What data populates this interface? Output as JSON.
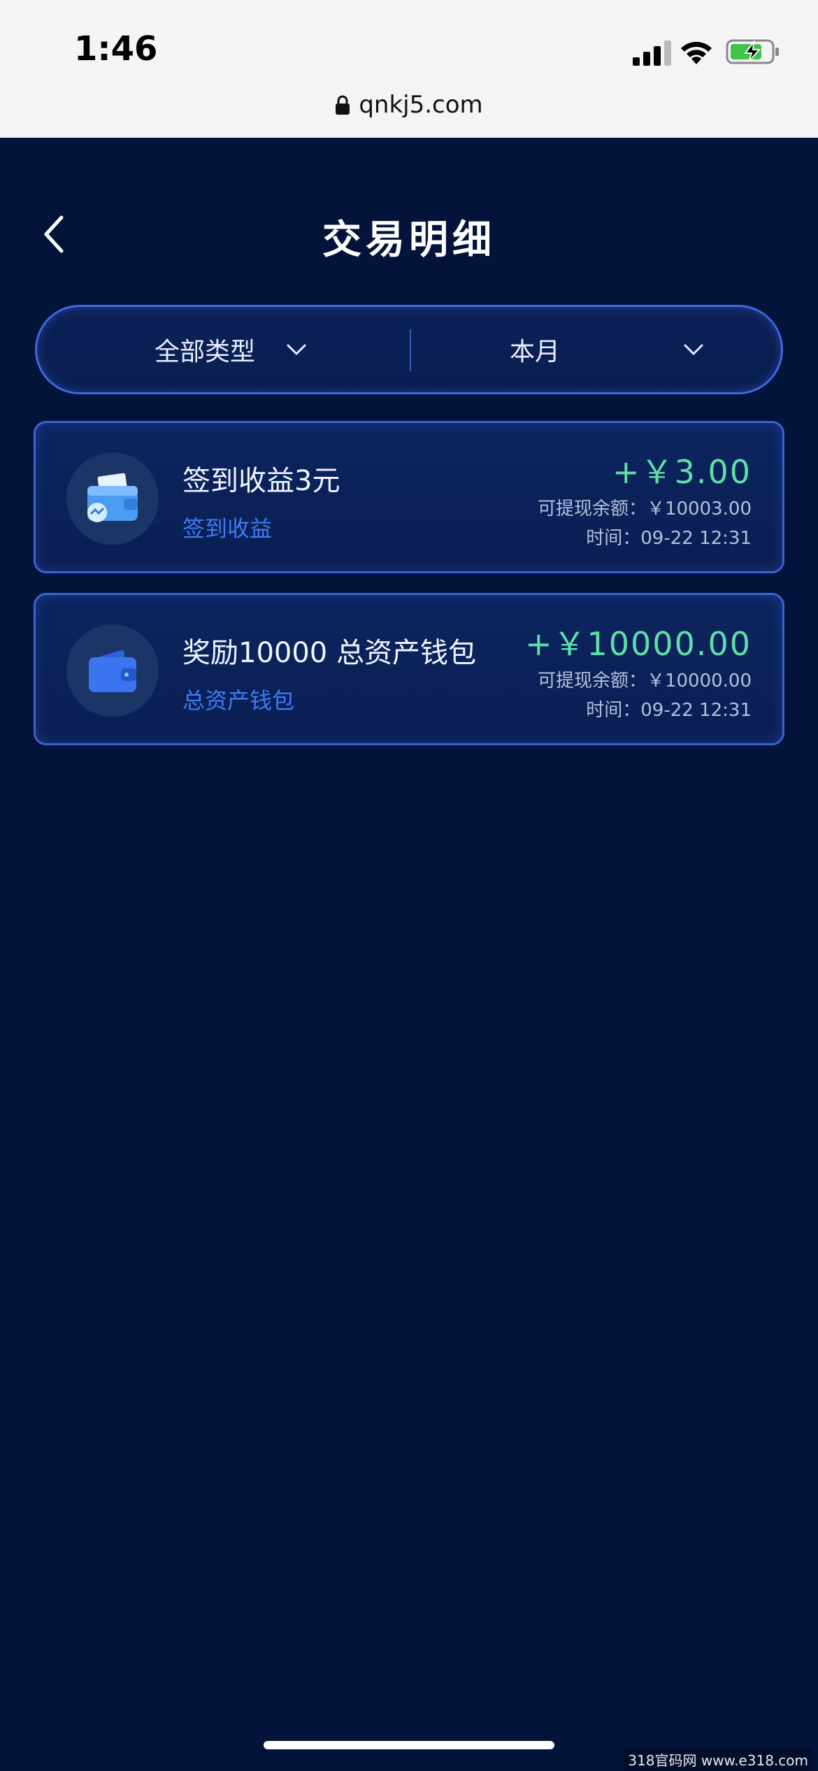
{
  "status_bar": {
    "time": "1:46",
    "url": "qnkj5.com"
  },
  "header": {
    "title": "交易明细"
  },
  "filters": {
    "type_label": "全部类型",
    "period_label": "本月"
  },
  "transactions": [
    {
      "title": "签到收益3元",
      "category": "签到收益",
      "amount": "+￥3.00",
      "balance": "可提现余额：￥10003.00",
      "time": "时间：09-22 12:31",
      "icon": "wallet-cash-icon"
    },
    {
      "title": "奖励10000 总资产钱包",
      "category": "总资产钱包",
      "amount": "+￥10000.00",
      "balance": "可提现余额：￥10000.00",
      "time": "时间：09-22 12:31",
      "icon": "wallet-icon"
    }
  ],
  "watermark": "318官码网 www.e318.com",
  "colors": {
    "background": "#03133a",
    "accent_border": "#3e68e0",
    "amount_green": "#5de0a8",
    "category_blue": "#3e7cf2"
  }
}
